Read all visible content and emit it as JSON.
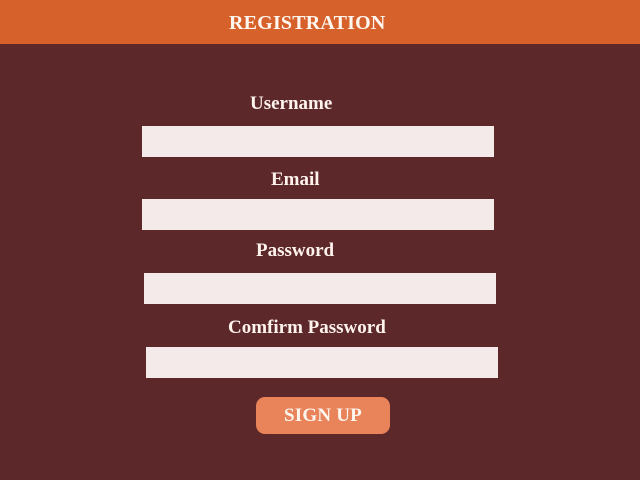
{
  "header": {
    "title": "REGISTRATION"
  },
  "form": {
    "username": {
      "label": "Username",
      "value": "",
      "placeholder": ""
    },
    "email": {
      "label": "Email",
      "value": "",
      "placeholder": ""
    },
    "password": {
      "label": "Password",
      "value": "",
      "placeholder": ""
    },
    "confirm_password": {
      "label": "Comfirm Password",
      "value": "",
      "placeholder": ""
    },
    "submit_label": "SIGN UP"
  },
  "colors": {
    "background": "#5c2829",
    "header": "#d7612a",
    "input": "#f5eaea",
    "button": "#e8835a",
    "text": "#fff3ee"
  }
}
